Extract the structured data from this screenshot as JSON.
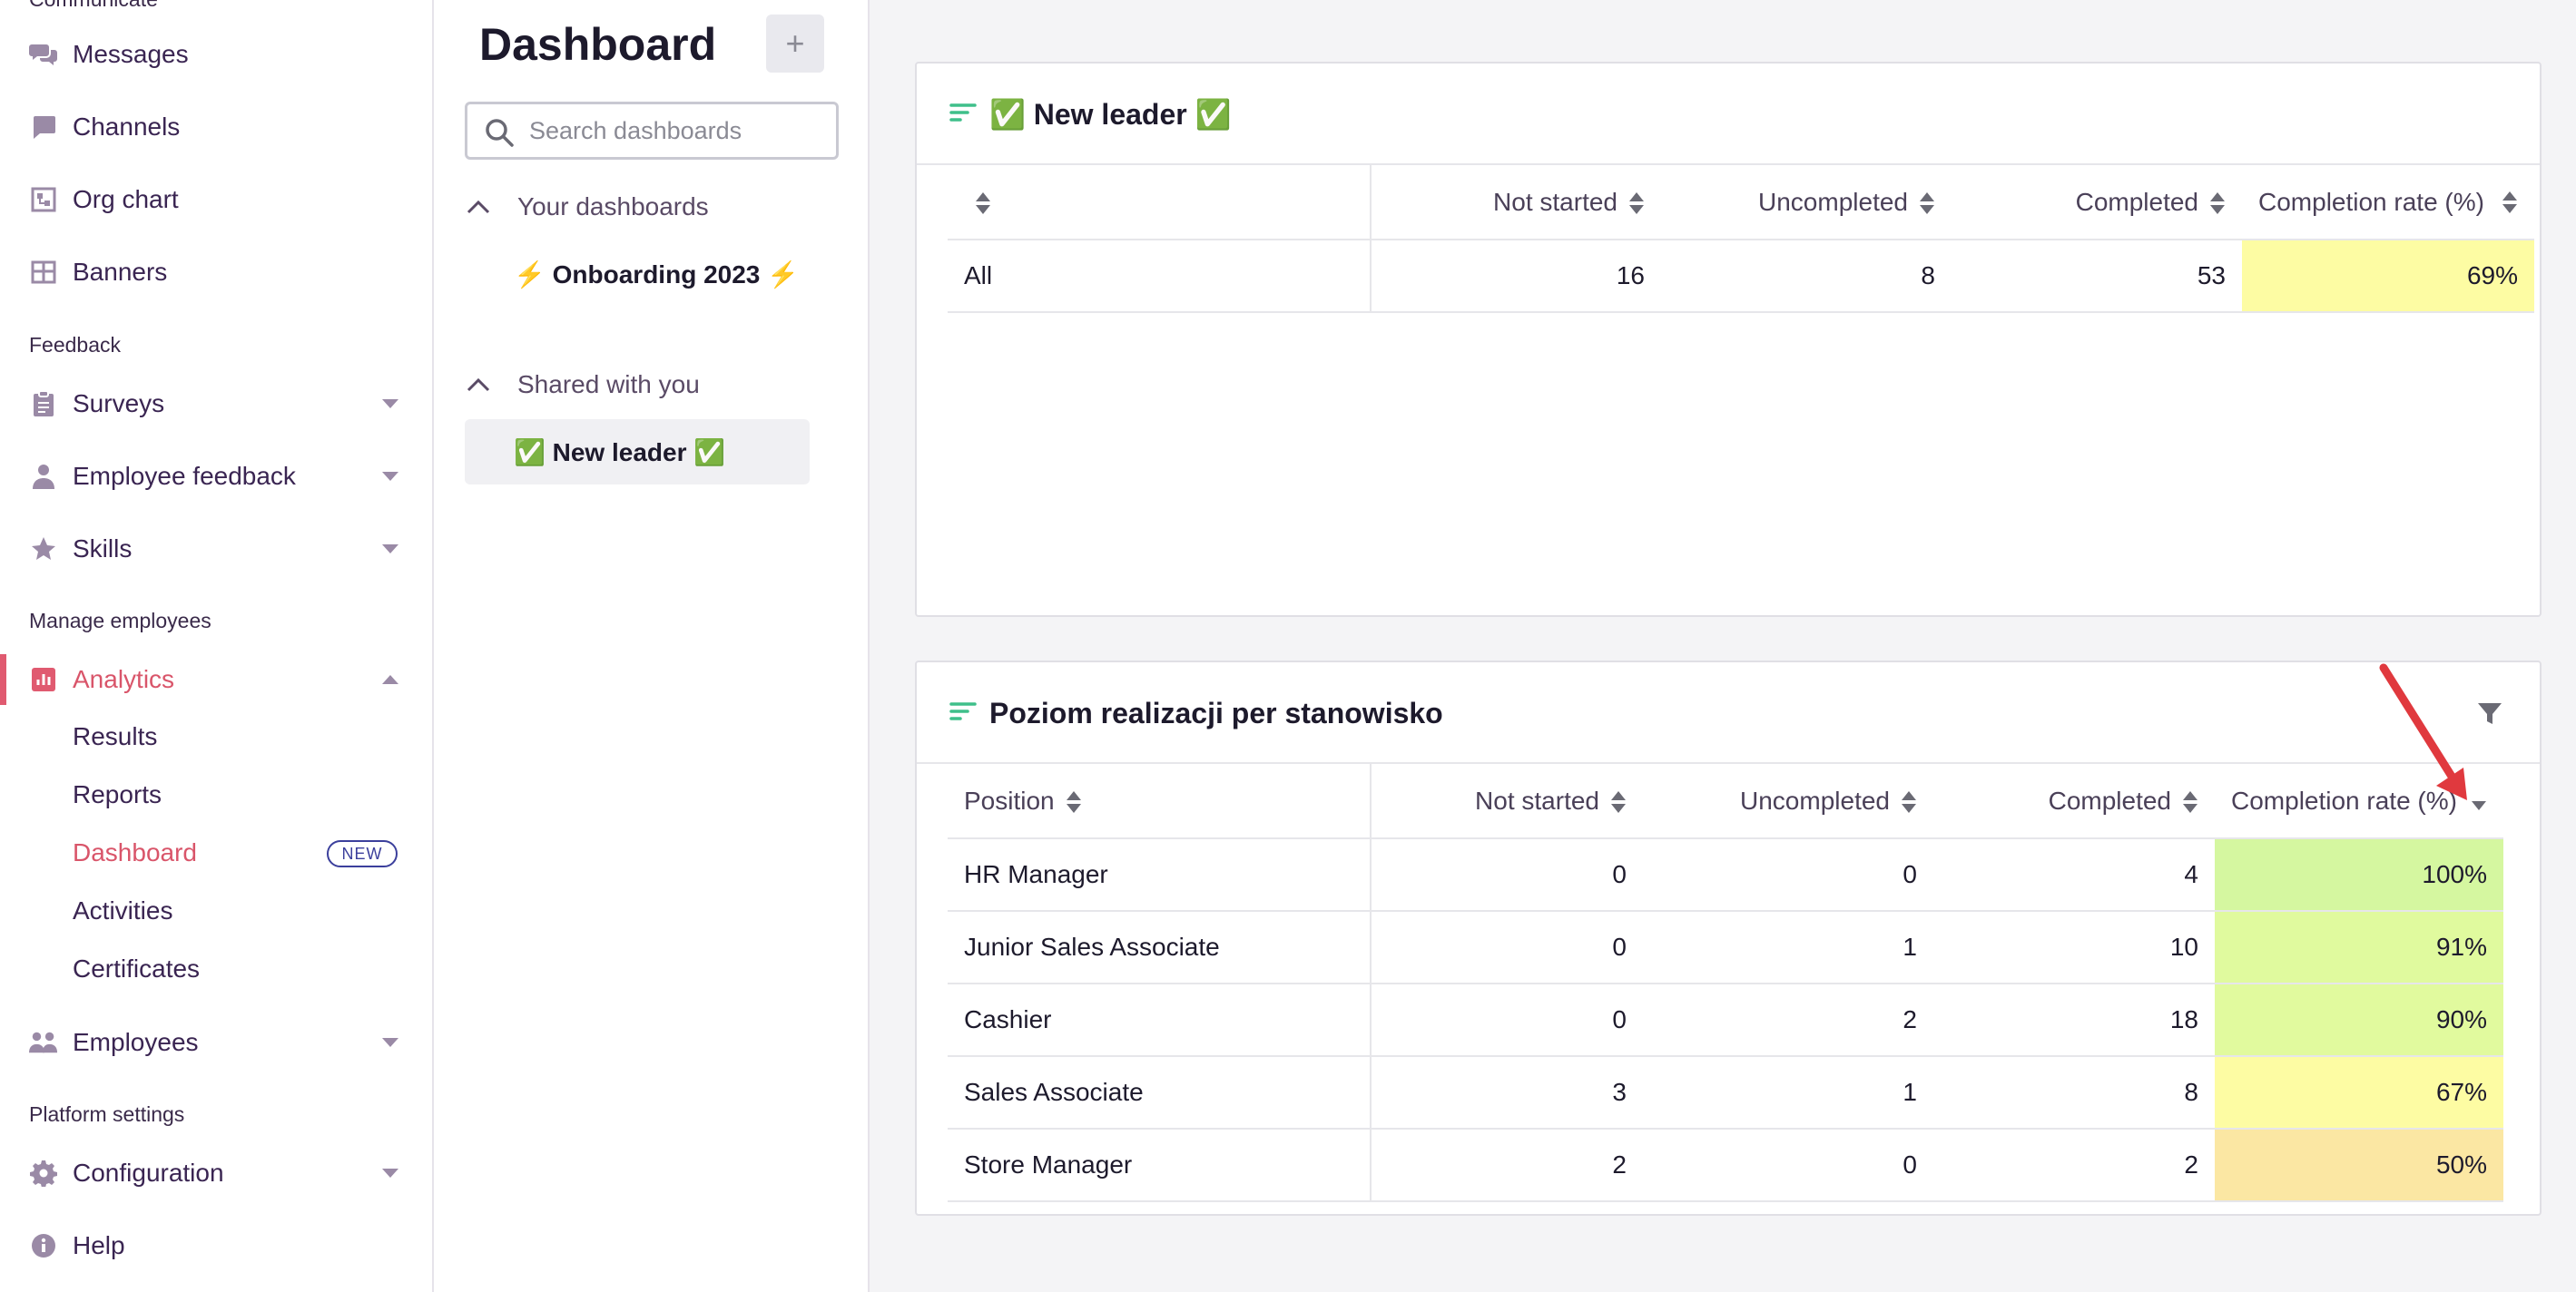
{
  "nav": {
    "top_section_partial": "Communicate",
    "items_communicate": [
      {
        "label": "Messages",
        "icon": "messages-icon"
      },
      {
        "label": "Channels",
        "icon": "channels-icon"
      },
      {
        "label": "Org chart",
        "icon": "org-chart-icon"
      },
      {
        "label": "Banners",
        "icon": "banners-icon"
      }
    ],
    "section_feedback": "Feedback",
    "items_feedback": [
      {
        "label": "Surveys",
        "icon": "clipboard-icon"
      },
      {
        "label": "Employee feedback",
        "icon": "person-icon"
      },
      {
        "label": "Skills",
        "icon": "star-icon"
      }
    ],
    "section_manage": "Manage employees",
    "analytics_label": "Analytics",
    "analytics_sub": [
      {
        "label": "Results"
      },
      {
        "label": "Reports"
      },
      {
        "label": "Dashboard",
        "badge": "NEW"
      },
      {
        "label": "Activities"
      },
      {
        "label": "Certificates"
      }
    ],
    "employees_label": "Employees",
    "section_platform": "Platform settings",
    "configuration_label": "Configuration",
    "help_label": "Help",
    "accent_color": "#d9556a"
  },
  "dashboards": {
    "title": "Dashboard",
    "add_label": "+",
    "search_placeholder": "Search dashboards",
    "your_dashboards_label": "Your dashboards",
    "your_items": [
      "⚡ Onboarding 2023 ⚡"
    ],
    "shared_label": "Shared with you",
    "shared_items": [
      "✅ New leader ✅"
    ]
  },
  "card1": {
    "title": "✅ New leader ✅",
    "columns": [
      "",
      "Not started",
      "Uncompleted",
      "Completed",
      "Completion rate (%)"
    ],
    "rows": [
      {
        "name": "All",
        "not_started": "16",
        "uncompleted": "8",
        "completed": "53",
        "rate": "69%",
        "rate_color": "#fdfca3"
      }
    ]
  },
  "card2": {
    "title": "Poziom realizacji per stanowisko",
    "columns": [
      "Position",
      "Not started",
      "Uncompleted",
      "Completed",
      "Completion rate (%)"
    ],
    "rows": [
      {
        "name": "HR Manager",
        "not_started": "0",
        "uncompleted": "0",
        "completed": "4",
        "rate": "100%",
        "rate_color": "#d5f7a0"
      },
      {
        "name": "Junior Sales Associate",
        "not_started": "0",
        "uncompleted": "1",
        "completed": "10",
        "rate": "91%",
        "rate_color": "#e0fa9e"
      },
      {
        "name": "Cashier",
        "not_started": "0",
        "uncompleted": "2",
        "completed": "18",
        "rate": "90%",
        "rate_color": "#e1fa9e"
      },
      {
        "name": "Sales Associate",
        "not_started": "3",
        "uncompleted": "1",
        "completed": "8",
        "rate": "67%",
        "rate_color": "#fdfca3"
      },
      {
        "name": "Store Manager",
        "not_started": "2",
        "uncompleted": "0",
        "completed": "2",
        "rate": "50%",
        "rate_color": "#fbe7a3"
      }
    ]
  }
}
